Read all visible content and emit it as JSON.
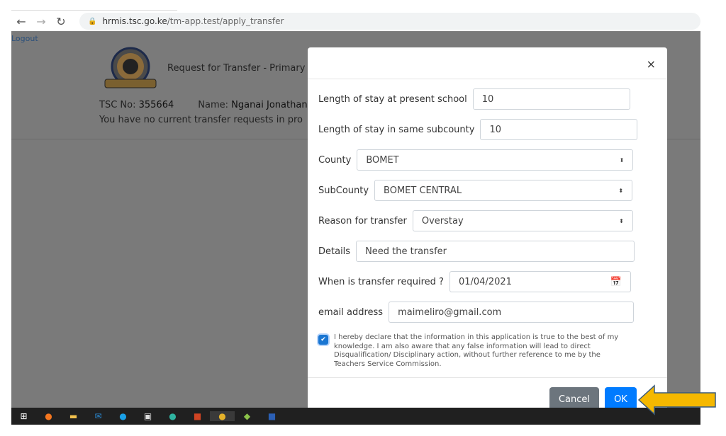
{
  "browser": {
    "url_host": "hrmis.tsc.go.ke",
    "url_path": "/tm-app.test/apply_transfer"
  },
  "page": {
    "logout": "Logout",
    "title": "Request for Transfer - Primary",
    "tsc_label": "TSC No:",
    "tsc_no": "355664",
    "name_label": "Name:",
    "name": "Nganai Jonathan",
    "message": "You have no current transfer requests in pro"
  },
  "modal": {
    "close": "×",
    "fields": [
      {
        "label": "Length of stay at present school",
        "value": "10"
      },
      {
        "label": "Length of stay in same subcounty",
        "value": "10"
      },
      {
        "label": "County",
        "value": "BOMET"
      },
      {
        "label": "SubCounty",
        "value": "BOMET CENTRAL"
      },
      {
        "label": "Reason for transfer",
        "value": "Overstay"
      },
      {
        "label": "Details",
        "value": "Need the transfer"
      },
      {
        "label": "When is transfer required ?",
        "value": "01/04/2021"
      },
      {
        "label": "email address",
        "value": "maimeliro@gmail.com"
      }
    ],
    "declaration": "I hereby declare that the information in this application is true to the best of my knowledge. I am also aware that any false information will lead to direct Disqualification/ Disciplinary action, without further reference to me by the Teachers Service Commission.",
    "declaration_checked": true,
    "cancel": "Cancel",
    "ok": "OK"
  },
  "taskbar": {
    "icons": [
      "windows-start",
      "firefox",
      "file-explorer",
      "mail",
      "skype",
      "store",
      "edge",
      "powerpoint",
      "chrome",
      "bluestacks",
      "word"
    ]
  },
  "colors": {
    "primary": "#007bff",
    "secondary": "#6c757d",
    "arrow": "#f5b800"
  }
}
